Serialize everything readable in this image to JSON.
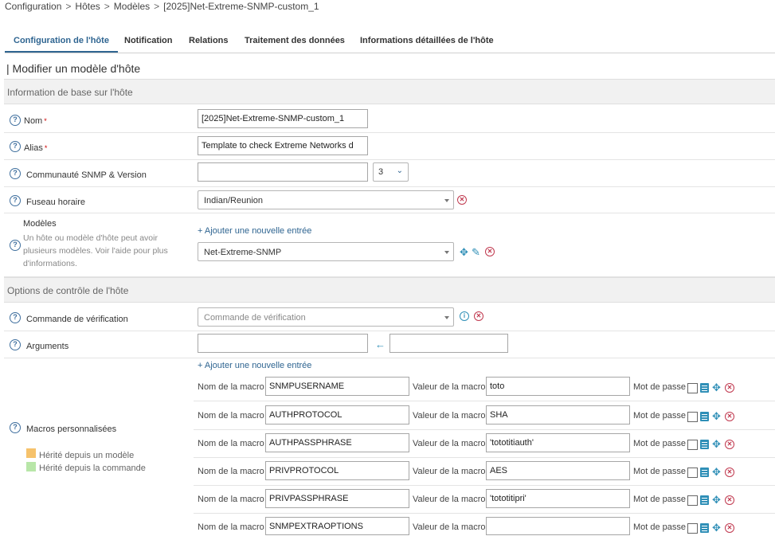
{
  "breadcrumb": [
    "Configuration",
    "Hôtes",
    "Modèles",
    "[2025]Net-Extreme-SNMP-custom_1"
  ],
  "tabs": [
    "Configuration de l'hôte",
    "Notification",
    "Relations",
    "Traitement des données",
    "Informations détaillées de l'hôte"
  ],
  "page_title": "| Modifier un modèle d'hôte",
  "section1": "Information de base sur l'hôte",
  "fields": {
    "name": {
      "label": "Nom",
      "value": "[2025]Net-Extreme-SNMP-custom_1"
    },
    "alias": {
      "label": "Alias",
      "value": "Template to check Extreme Networks d"
    },
    "snmp": {
      "label": "Communauté SNMP & Version",
      "value": "",
      "version": "3"
    },
    "timezone": {
      "label": "Fuseau horaire",
      "value": "Indian/Reunion"
    },
    "templates": {
      "label": "Modèles",
      "help": "Un hôte ou modèle d'hôte peut avoir plusieurs modèles. Voir l'aide pour plus d'informations.",
      "add": "+ Ajouter une nouvelle entrée",
      "value": "Net-Extreme-SNMP"
    }
  },
  "section2": "Options de contrôle de l'hôte",
  "check": {
    "command_label": "Commande de vérification",
    "command_placeholder": "Commande de vérification",
    "args_label": "Arguments",
    "args_value": "",
    "args_value2": ""
  },
  "macros": {
    "label": "Macros personnalisées",
    "add": "+ Ajouter une nouvelle entrée",
    "name_label": "Nom de la macro",
    "value_label": "Valeur de la macro",
    "password_label": "Mot de passe",
    "legend_template": "Hérité depuis un modèle",
    "legend_command": "Hérité depuis la commande",
    "legend_template_color": "#f6c26b",
    "legend_command_color": "#b8e6a8",
    "items": [
      {
        "name": "SNMPUSERNAME",
        "value": "toto"
      },
      {
        "name": "AUTHPROTOCOL",
        "value": "SHA"
      },
      {
        "name": "AUTHPASSPHRASE",
        "value": "'tototitiauth'"
      },
      {
        "name": "PRIVPROTOCOL",
        "value": "AES"
      },
      {
        "name": "PRIVPASSPHRASE",
        "value": "'tototitipri'"
      },
      {
        "name": "SNMPEXTRAOPTIONS",
        "value": ""
      }
    ]
  }
}
